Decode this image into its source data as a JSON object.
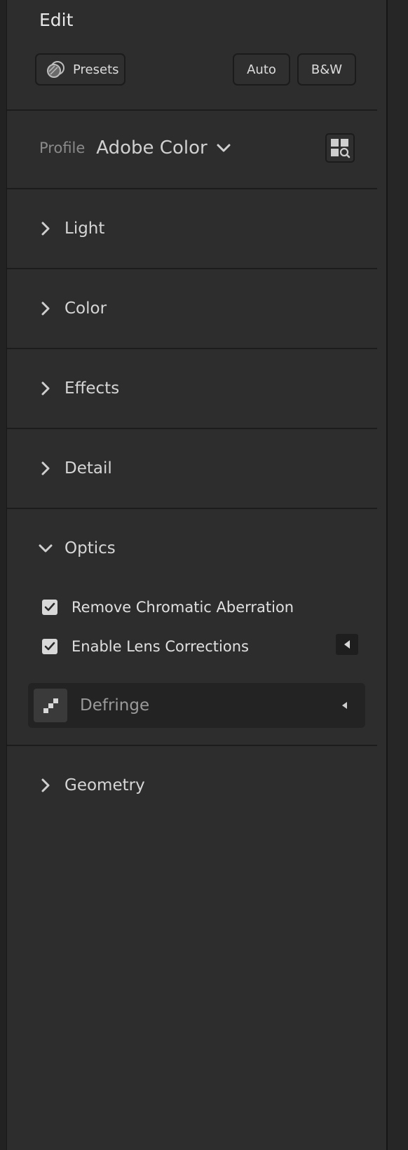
{
  "header": {
    "title": "Edit",
    "presets_label": "Presets",
    "auto_label": "Auto",
    "bw_label": "B&W"
  },
  "profile": {
    "label": "Profile",
    "value": "Adobe Color"
  },
  "sections": {
    "light": "Light",
    "color": "Color",
    "effects": "Effects",
    "detail": "Detail",
    "optics": "Optics",
    "geometry": "Geometry"
  },
  "optics": {
    "remove_ca": {
      "label": "Remove Chromatic Aberration",
      "checked": true
    },
    "lens_corrections": {
      "label": "Enable Lens Corrections",
      "checked": true
    },
    "defringe_label": "Defringe"
  },
  "icons": {
    "presets": "presets-icon",
    "profile_dropdown": "chevron-down-icon",
    "profile_browser": "grid-search-icon",
    "collapsed": "chevron-right-icon",
    "expanded": "chevron-down-icon",
    "checkbox": "checkmark-icon",
    "lens_expand": "triangle-left-icon",
    "defringe": "defringe-icon"
  },
  "colors": {
    "panel_bg": "#2d2d2d",
    "text": "#d6d6d6",
    "muted_text": "#8a8a8a",
    "checkbox_bg": "#d8d8d8"
  }
}
